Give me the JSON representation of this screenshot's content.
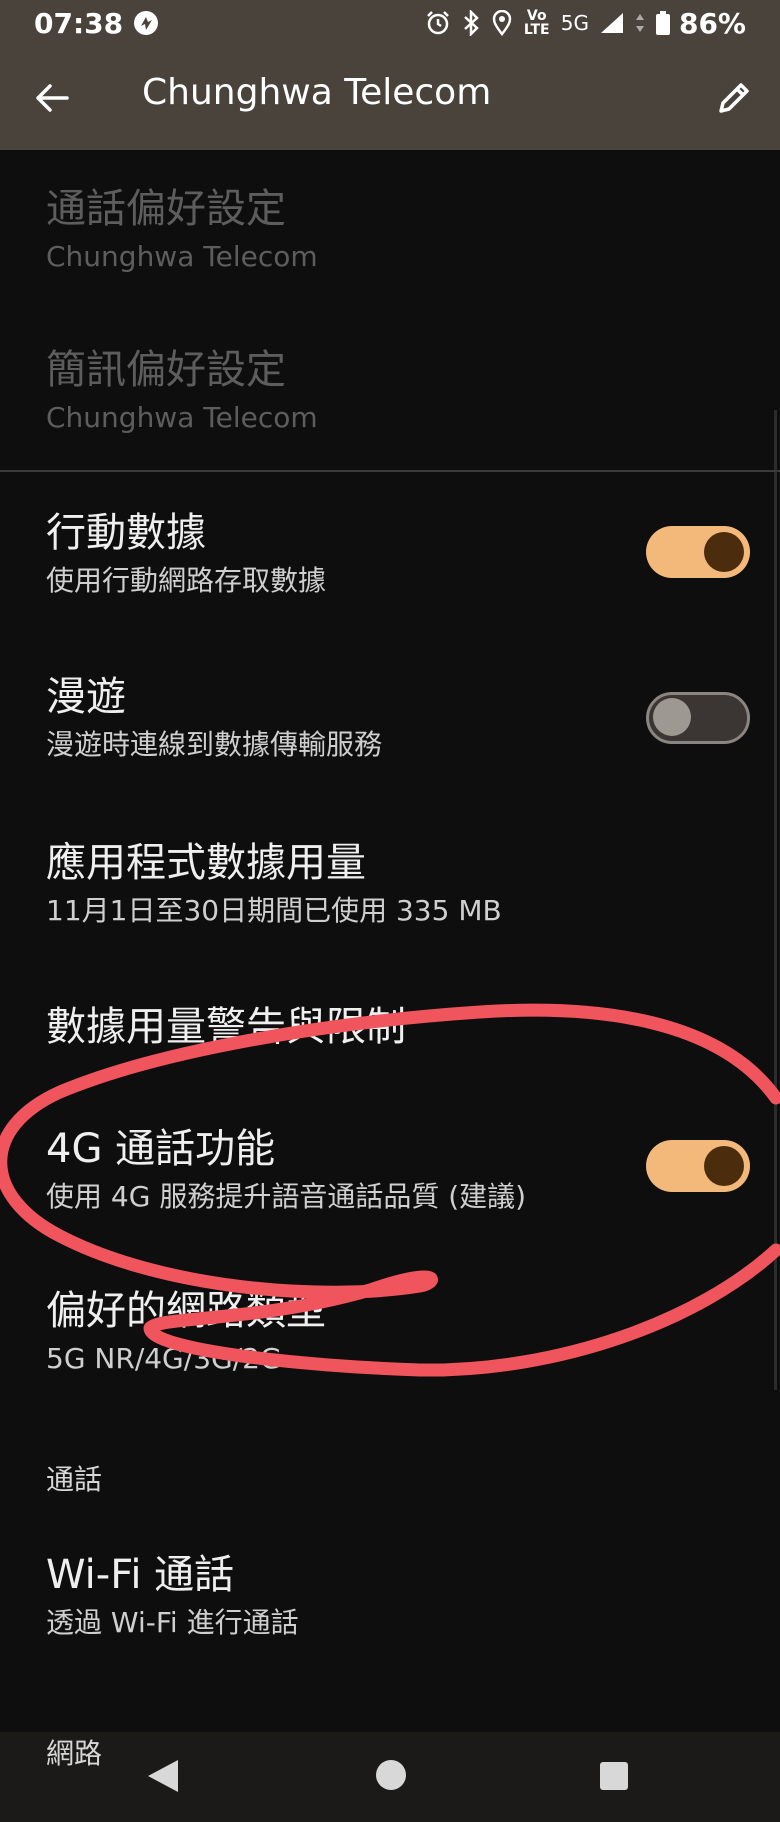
{
  "status_bar": {
    "time": "07:38",
    "network": "5G",
    "battery": "86%",
    "volte": "Vo LTE"
  },
  "app_bar": {
    "title": "Chunghwa Telecom"
  },
  "items": {
    "call_prefs": {
      "title": "通話偏好設定",
      "subtitle": "Chunghwa Telecom"
    },
    "sms_prefs": {
      "title": "簡訊偏好設定",
      "subtitle": "Chunghwa Telecom"
    },
    "mobile_data": {
      "title": "行動數據",
      "subtitle": "使用行動網路存取數據",
      "enabled": true
    },
    "roaming": {
      "title": "漫遊",
      "subtitle": "漫遊時連線到數據傳輸服務",
      "enabled": false
    },
    "app_data_usage": {
      "title": "應用程式數據用量",
      "subtitle": "11月1日至30日期間已使用 335 MB"
    },
    "data_warning": {
      "title": "數據用量警告與限制"
    },
    "volte_4g": {
      "title": "4G 通話功能",
      "subtitle": "使用 4G 服務提升語音通話品質 (建議)",
      "enabled": true
    },
    "preferred_network": {
      "title": "偏好的網路類型",
      "subtitle": "5G NR/4G/3G/2G"
    },
    "wifi_calling": {
      "title": "Wi-Fi 通話",
      "subtitle": "透過 Wi-Fi 進行通話"
    }
  },
  "sections": {
    "calls": "通話",
    "network": "網路"
  },
  "colors": {
    "app_bar": "#4a433c",
    "background": "#0e0e0e",
    "toggle_on": "#f2b97b",
    "toggle_knob_on": "#4b2d0e",
    "annotation": "#f0545c"
  }
}
